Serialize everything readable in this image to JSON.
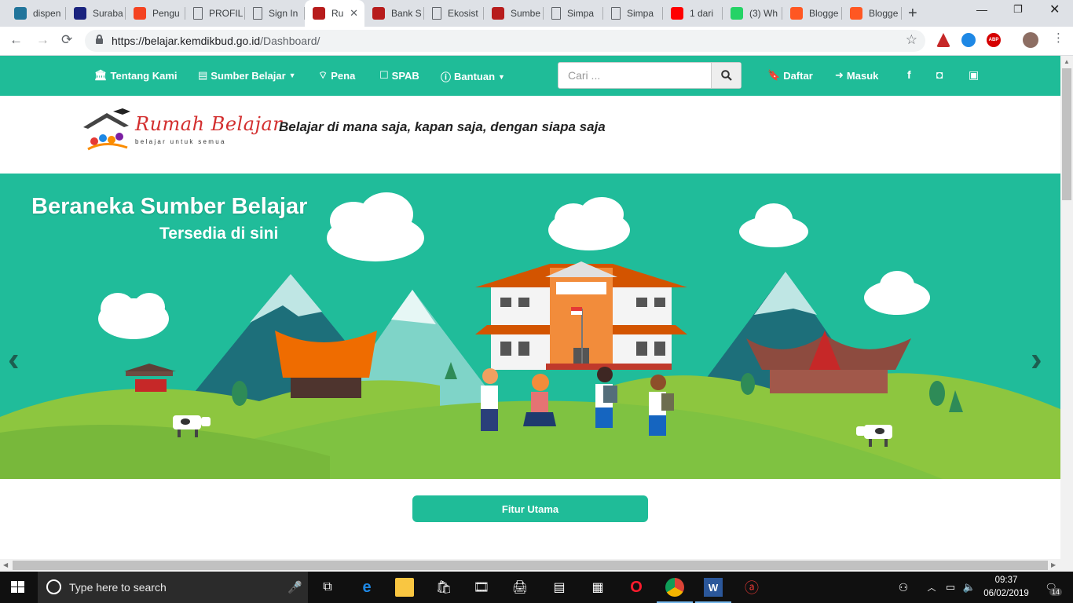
{
  "browser": {
    "tabs": [
      {
        "label": "dispen",
        "icon": "wordpress-icon",
        "color": "#21759b"
      },
      {
        "label": "Suraba",
        "icon": "city-crest-icon",
        "color": "#1a237e"
      },
      {
        "label": "Pengu",
        "icon": "joomla-icon",
        "color": "#f44321"
      },
      {
        "label": "PROFIL",
        "icon": "page-icon",
        "color": "#5f6368"
      },
      {
        "label": "Sign In",
        "icon": "page-icon",
        "color": "#5f6368"
      },
      {
        "label": "Ru",
        "icon": "rumah-belajar-icon",
        "color": "#b71c1c",
        "active": true
      },
      {
        "label": "Bank S",
        "icon": "rumah-belajar-icon",
        "color": "#b71c1c"
      },
      {
        "label": "Ekosist",
        "icon": "page-icon",
        "color": "#5f6368"
      },
      {
        "label": "Sumbe",
        "icon": "rumah-belajar-icon",
        "color": "#b71c1c"
      },
      {
        "label": "Simpa",
        "icon": "page-icon",
        "color": "#5f6368"
      },
      {
        "label": "Simpa",
        "icon": "page-icon",
        "color": "#5f6368"
      },
      {
        "label": "1 dari",
        "icon": "youtube-icon",
        "color": "#ff0000"
      },
      {
        "label": "(3) Wh",
        "icon": "whatsapp-icon",
        "color": "#25d366"
      },
      {
        "label": "Blogge",
        "icon": "blogger-icon",
        "color": "#ff5722"
      },
      {
        "label": "Blogge",
        "icon": "blogger-icon",
        "color": "#ff5722"
      }
    ],
    "url_host": "https://belajar.kemdikbud.go.id",
    "url_path": "/Dashboard/"
  },
  "site": {
    "nav": {
      "tentang": "Tentang Kami",
      "sumber": "Sumber Belajar",
      "pena": "Pena",
      "spab": "SPAB",
      "bantuan": "Bantuan",
      "daftar": "Daftar",
      "masuk": "Masuk"
    },
    "search_placeholder": "Cari ...",
    "social": {
      "facebook": "f",
      "instagram": "◘",
      "youtube": "▣"
    },
    "logo_title": "Rumah Belajar",
    "logo_subtitle": "belajar untuk semua",
    "tagline": "Belajar di mana saja, kapan saja, dengan siapa saja",
    "hero_title": "Beraneka Sumber Belajar",
    "hero_subtitle": "Tersedia di sini",
    "fitur_button": "Fitur Utama",
    "colors": {
      "primary": "#1fbc98",
      "hill": "#7fc241",
      "mountain": "#1d6f7a"
    }
  },
  "taskbar": {
    "search_placeholder": "Type here to search",
    "time": "09:37",
    "date": "06/02/2019",
    "notifications": "14"
  }
}
